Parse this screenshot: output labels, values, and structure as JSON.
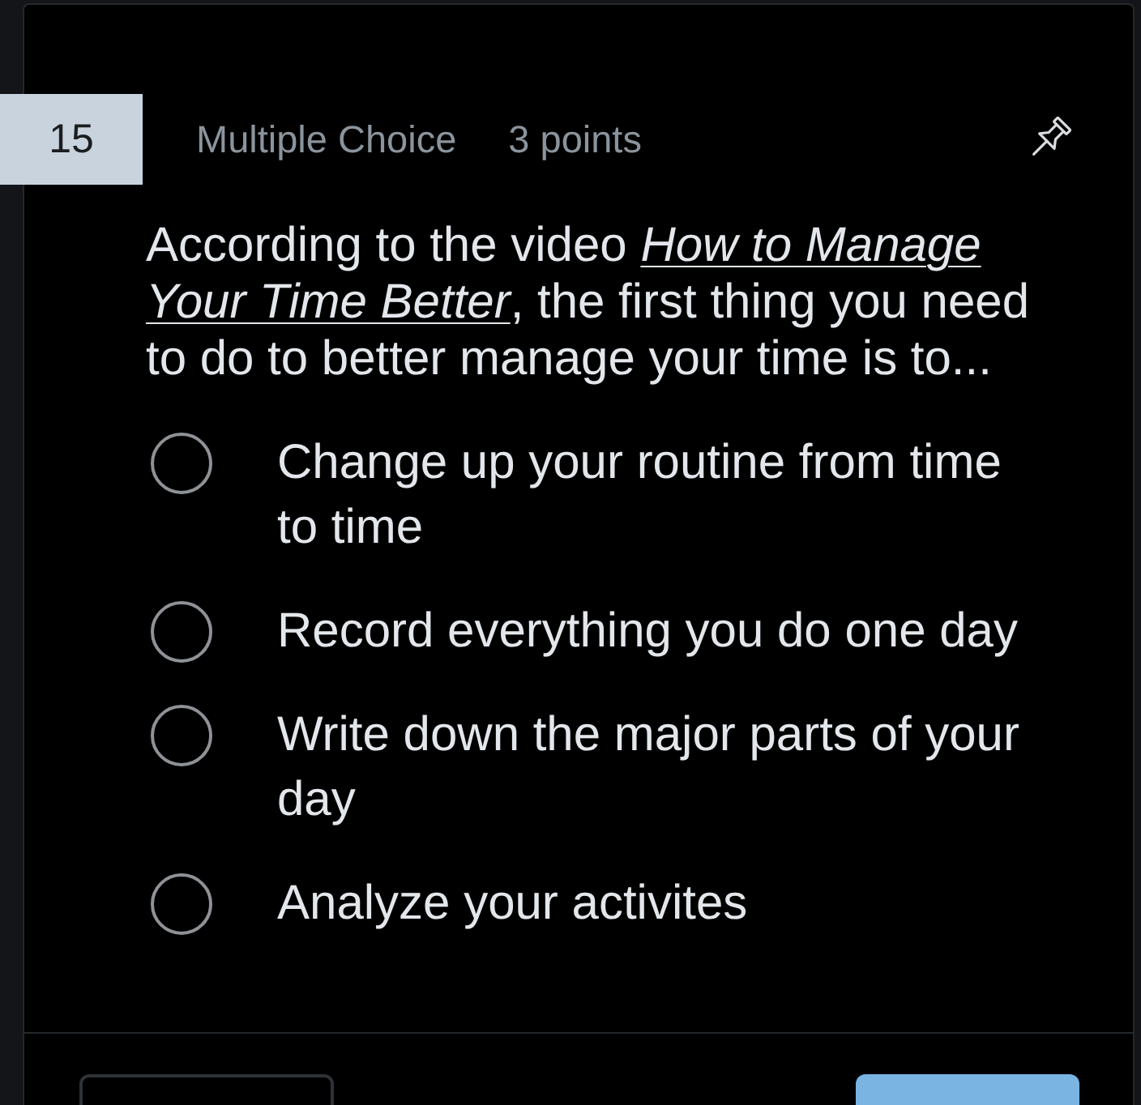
{
  "question": {
    "number": "15",
    "type": "Multiple Choice",
    "points": "3 points",
    "text": "According to the video *How to Manage Your Time Better*, the first thing you need to do to better manage your time is to...",
    "answers": [
      {
        "text": "Change up your routine from time to time",
        "selected": false
      },
      {
        "text": "Record everything you do one day",
        "selected": false
      },
      {
        "text": "Write down the major parts of your day",
        "selected": false
      },
      {
        "text": "Analyze your activites",
        "selected": false
      }
    ]
  },
  "footer": {
    "buttons": [
      {
        "kind": "outline"
      },
      {
        "kind": "primary"
      }
    ]
  }
}
